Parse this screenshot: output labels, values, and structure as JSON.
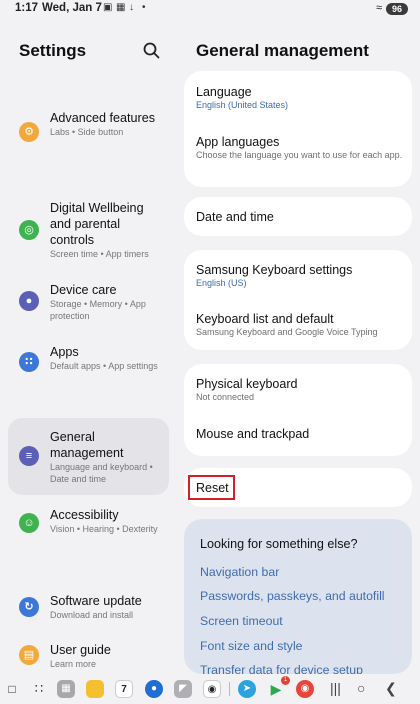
{
  "status": {
    "time": "1:17",
    "date": "Wed, Jan 7",
    "battery": "96"
  },
  "left": {
    "title": "Settings",
    "items": [
      {
        "label": "Advanced features",
        "sub": "Labs • Side button",
        "color": "#f2a93b",
        "icon": "⚙"
      },
      {
        "label": "Digital Wellbeing and parental controls",
        "sub": "Screen time • App timers",
        "color": "#3fb34f",
        "icon": "◎"
      },
      {
        "label": "Device care",
        "sub": "Storage • Memory • App protection",
        "color": "#5b5fb6",
        "icon": "●"
      },
      {
        "label": "Apps",
        "sub": "Default apps • App settings",
        "color": "#3d77d8",
        "icon": "∷"
      },
      {
        "label": "General management",
        "sub": "Language and keyboard • Date and time",
        "color": "#5b5fb6",
        "icon": "≡"
      },
      {
        "label": "Accessibility",
        "sub": "Vision • Hearing • Dexterity",
        "color": "#3fb34f",
        "icon": "☺"
      },
      {
        "label": "Software update",
        "sub": "Download and install",
        "color": "#3d77d8",
        "icon": "↻"
      },
      {
        "label": "User guide",
        "sub": "Learn more",
        "color": "#f2a93b",
        "icon": "▤"
      }
    ]
  },
  "right": {
    "title": "General management",
    "language": {
      "label": "Language",
      "sub": "English (United States)"
    },
    "app_languages": {
      "label": "App languages",
      "sub": "Choose the language you want to use for each app."
    },
    "date_time": {
      "label": "Date and time"
    },
    "samsung_keyboard": {
      "label": "Samsung Keyboard settings",
      "sub": "English (US)"
    },
    "keyboard_list": {
      "label": "Keyboard list and default",
      "sub": "Samsung Keyboard and Google Voice Typing"
    },
    "physical_keyboard": {
      "label": "Physical keyboard",
      "sub": "Not connected"
    },
    "mouse_trackpad": {
      "label": "Mouse and trackpad"
    },
    "reset": {
      "label": "Reset"
    },
    "suggest": {
      "title": "Looking for something else?",
      "links": [
        "Navigation bar",
        "Passwords, passkeys, and autofill",
        "Screen timeout",
        "Font size and style",
        "Transfer data for device setup"
      ]
    }
  },
  "taskbar": {
    "calendar_day": "7",
    "play_badge": "1"
  }
}
